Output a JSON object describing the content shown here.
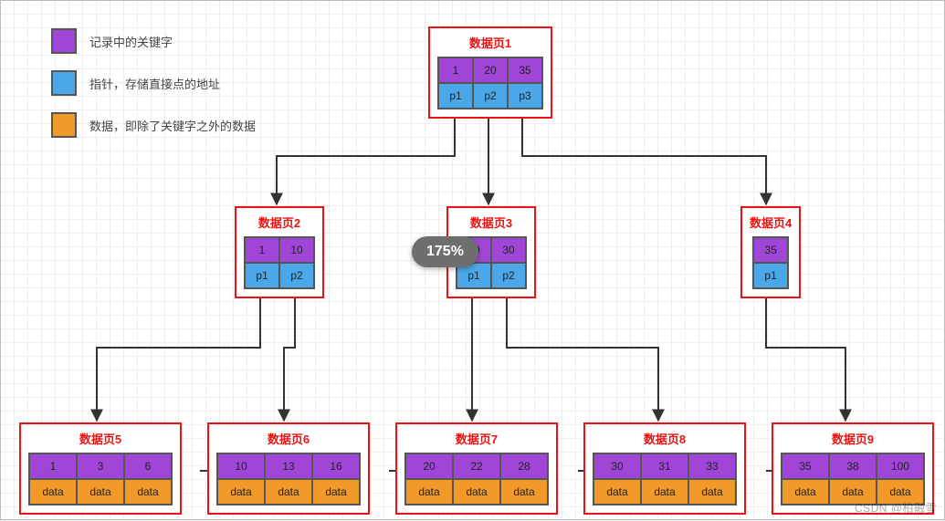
{
  "legend": {
    "purple": "记录中的关键字",
    "blue": "指针，存储直接点的地址",
    "orange": "数据，即除了关键字之外的数据"
  },
  "colors": {
    "key": "#a046d6",
    "ptr": "#4aa8e8",
    "data": "#f19a2a",
    "node_border": "#e11"
  },
  "zoom_label": "175%",
  "watermark": "CSDN @柏融雪",
  "nodes": {
    "root": {
      "title": "数据页1",
      "keys": [
        "1",
        "20",
        "35"
      ],
      "ptrs": [
        "p1",
        "p2",
        "p3"
      ]
    },
    "inner2": {
      "title": "数据页2",
      "keys": [
        "1",
        "10"
      ],
      "ptrs": [
        "p1",
        "p2"
      ]
    },
    "inner3": {
      "title": "数据页3",
      "keys": [
        "20",
        "30"
      ],
      "ptrs": [
        "p1",
        "p2"
      ]
    },
    "inner4": {
      "title": "数据页4",
      "keys": [
        "35"
      ],
      "ptrs": [
        "p1"
      ]
    },
    "leaf5": {
      "title": "数据页5",
      "keys": [
        "1",
        "3",
        "6"
      ],
      "data": [
        "data",
        "data",
        "data"
      ]
    },
    "leaf6": {
      "title": "数据页6",
      "keys": [
        "10",
        "13",
        "16"
      ],
      "data": [
        "data",
        "data",
        "data"
      ]
    },
    "leaf7": {
      "title": "数据页7",
      "keys": [
        "20",
        "22",
        "28"
      ],
      "data": [
        "data",
        "data",
        "data"
      ]
    },
    "leaf8": {
      "title": "数据页8",
      "keys": [
        "30",
        "31",
        "33"
      ],
      "data": [
        "data",
        "data",
        "data"
      ]
    },
    "leaf9": {
      "title": "数据页9",
      "keys": [
        "35",
        "38",
        "100"
      ],
      "data": [
        "data",
        "data",
        "data"
      ]
    }
  },
  "chart_data": {
    "type": "table",
    "structure": "b+tree-like index diagram",
    "root": {
      "page": 1,
      "entries": [
        {
          "key": 1,
          "ptr": "p1",
          "child_page": 2
        },
        {
          "key": 20,
          "ptr": "p2",
          "child_page": 3
        },
        {
          "key": 35,
          "ptr": "p3",
          "child_page": 4
        }
      ]
    },
    "internal": [
      {
        "page": 2,
        "entries": [
          {
            "key": 1,
            "ptr": "p1",
            "child_page": 5
          },
          {
            "key": 10,
            "ptr": "p2",
            "child_page": 6
          }
        ]
      },
      {
        "page": 3,
        "entries": [
          {
            "key": 20,
            "ptr": "p1",
            "child_page": 7
          },
          {
            "key": 30,
            "ptr": "p2",
            "child_page": 8
          }
        ]
      },
      {
        "page": 4,
        "entries": [
          {
            "key": 35,
            "ptr": "p1",
            "child_page": 9
          }
        ]
      }
    ],
    "leaves": [
      {
        "page": 5,
        "records": [
          {
            "key": 1,
            "data": "data"
          },
          {
            "key": 3,
            "data": "data"
          },
          {
            "key": 6,
            "data": "data"
          }
        ],
        "next_page": 6
      },
      {
        "page": 6,
        "records": [
          {
            "key": 10,
            "data": "data"
          },
          {
            "key": 13,
            "data": "data"
          },
          {
            "key": 16,
            "data": "data"
          }
        ],
        "next_page": 7
      },
      {
        "page": 7,
        "records": [
          {
            "key": 20,
            "data": "data"
          },
          {
            "key": 22,
            "data": "data"
          },
          {
            "key": 28,
            "data": "data"
          }
        ],
        "next_page": 8
      },
      {
        "page": 8,
        "records": [
          {
            "key": 30,
            "data": "data"
          },
          {
            "key": 31,
            "data": "data"
          },
          {
            "key": 33,
            "data": "data"
          }
        ],
        "next_page": 9
      },
      {
        "page": 9,
        "records": [
          {
            "key": 35,
            "data": "data"
          },
          {
            "key": 38,
            "data": "data"
          },
          {
            "key": 100,
            "data": "data"
          }
        ],
        "next_page": null
      }
    ],
    "leaf_chain_direction": "left-to-right"
  }
}
